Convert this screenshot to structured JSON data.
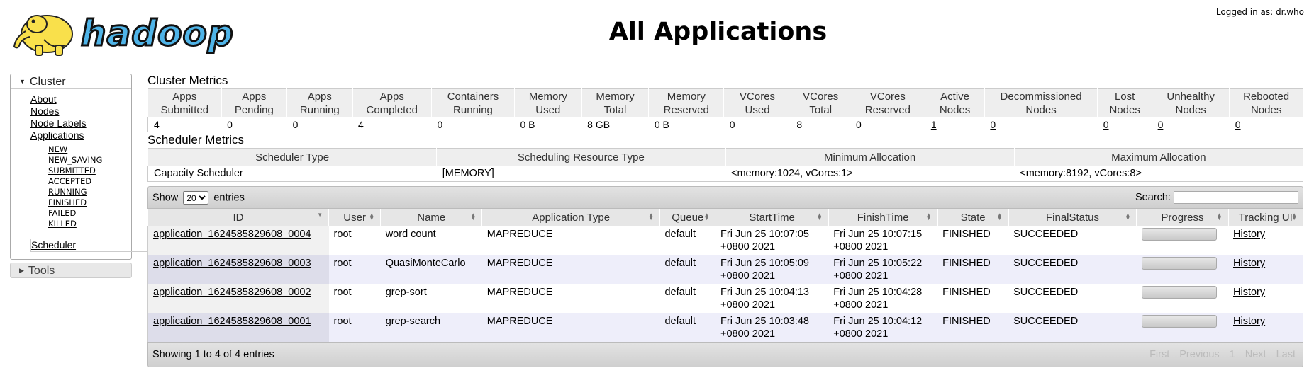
{
  "header": {
    "logo_text": "hadoop",
    "title": "All Applications",
    "login": "Logged in as: dr.who"
  },
  "sidebar": {
    "cluster_label": "Cluster",
    "links": [
      "About",
      "Nodes",
      "Node Labels",
      "Applications"
    ],
    "app_states": [
      "NEW",
      "NEW_SAVING",
      "SUBMITTED",
      "ACCEPTED",
      "RUNNING",
      "FINISHED",
      "FAILED",
      "KILLED"
    ],
    "scheduler_label": "Scheduler",
    "tools_label": "Tools"
  },
  "cluster_metrics": {
    "title": "Cluster Metrics",
    "headers": [
      [
        "Apps",
        "Submitted"
      ],
      [
        "Apps",
        "Pending"
      ],
      [
        "Apps",
        "Running"
      ],
      [
        "Apps",
        "Completed"
      ],
      [
        "Containers",
        "Running"
      ],
      [
        "Memory",
        "Used"
      ],
      [
        "Memory",
        "Total"
      ],
      [
        "Memory",
        "Reserved"
      ],
      [
        "VCores",
        "Used"
      ],
      [
        "VCores",
        "Total"
      ],
      [
        "VCores",
        "Reserved"
      ],
      [
        "Active",
        "Nodes"
      ],
      [
        "Decommissioned",
        "Nodes"
      ],
      [
        "Lost",
        "Nodes"
      ],
      [
        "Unhealthy",
        "Nodes"
      ],
      [
        "Rebooted",
        "Nodes"
      ]
    ],
    "values": [
      "4",
      "0",
      "0",
      "4",
      "0",
      "0 B",
      "8 GB",
      "0 B",
      "0",
      "8",
      "0",
      "1",
      "0",
      "0",
      "0",
      "0"
    ]
  },
  "scheduler_metrics": {
    "title": "Scheduler Metrics",
    "headers": [
      "Scheduler Type",
      "Scheduling Resource Type",
      "Minimum Allocation",
      "Maximum Allocation"
    ],
    "values": [
      "Capacity Scheduler",
      "[MEMORY]",
      "<memory:1024, vCores:1>",
      "<memory:8192, vCores:8>"
    ]
  },
  "apps_table": {
    "show_label": "Show",
    "entries_label": "entries",
    "page_size": "20",
    "search_label": "Search:",
    "columns": [
      "ID",
      "User",
      "Name",
      "Application Type",
      "Queue",
      "StartTime",
      "FinishTime",
      "State",
      "FinalStatus",
      "Progress",
      "Tracking UI"
    ],
    "rows": [
      {
        "id": "application_1624585829608_0004",
        "user": "root",
        "name": "word count",
        "type": "MAPREDUCE",
        "queue": "default",
        "start1": "Fri Jun 25 10:07:05",
        "start2": "+0800 2021",
        "finish1": "Fri Jun 25 10:07:15",
        "finish2": "+0800 2021",
        "state": "FINISHED",
        "final": "SUCCEEDED",
        "progress": 100,
        "tracking": "History"
      },
      {
        "id": "application_1624585829608_0003",
        "user": "root",
        "name": "QuasiMonteCarlo",
        "type": "MAPREDUCE",
        "queue": "default",
        "start1": "Fri Jun 25 10:05:09",
        "start2": "+0800 2021",
        "finish1": "Fri Jun 25 10:05:22",
        "finish2": "+0800 2021",
        "state": "FINISHED",
        "final": "SUCCEEDED",
        "progress": 100,
        "tracking": "History"
      },
      {
        "id": "application_1624585829608_0002",
        "user": "root",
        "name": "grep-sort",
        "type": "MAPREDUCE",
        "queue": "default",
        "start1": "Fri Jun 25 10:04:13",
        "start2": "+0800 2021",
        "finish1": "Fri Jun 25 10:04:28",
        "finish2": "+0800 2021",
        "state": "FINISHED",
        "final": "SUCCEEDED",
        "progress": 100,
        "tracking": "History"
      },
      {
        "id": "application_1624585829608_0001",
        "user": "root",
        "name": "grep-search",
        "type": "MAPREDUCE",
        "queue": "default",
        "start1": "Fri Jun 25 10:03:48",
        "start2": "+0800 2021",
        "finish1": "Fri Jun 25 10:04:12",
        "finish2": "+0800 2021",
        "state": "FINISHED",
        "final": "SUCCEEDED",
        "progress": 100,
        "tracking": "History"
      }
    ],
    "info": "Showing 1 to 4 of 4 entries",
    "pager": [
      "First",
      "Previous",
      "1",
      "Next",
      "Last"
    ]
  }
}
